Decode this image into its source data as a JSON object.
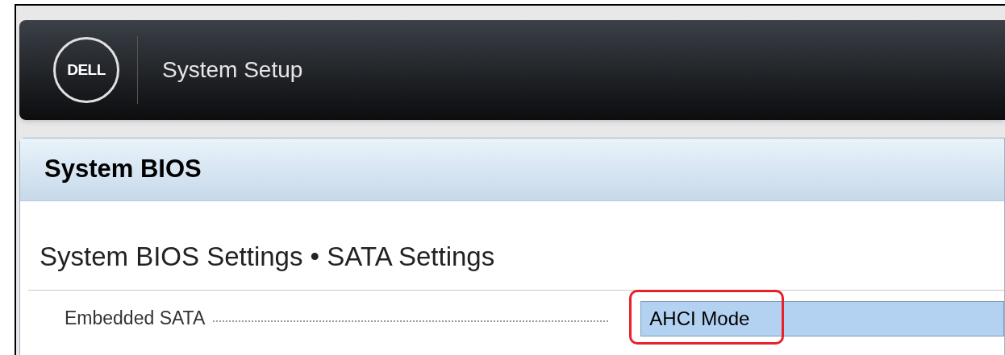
{
  "header": {
    "logo": "DELL",
    "title": "System Setup"
  },
  "panel": {
    "title": "System BIOS",
    "subtitle": "System BIOS Settings • SATA Settings"
  },
  "settings": [
    {
      "label": "Embedded SATA",
      "value": "AHCI Mode",
      "selected": true,
      "highlighted": true
    }
  ]
}
